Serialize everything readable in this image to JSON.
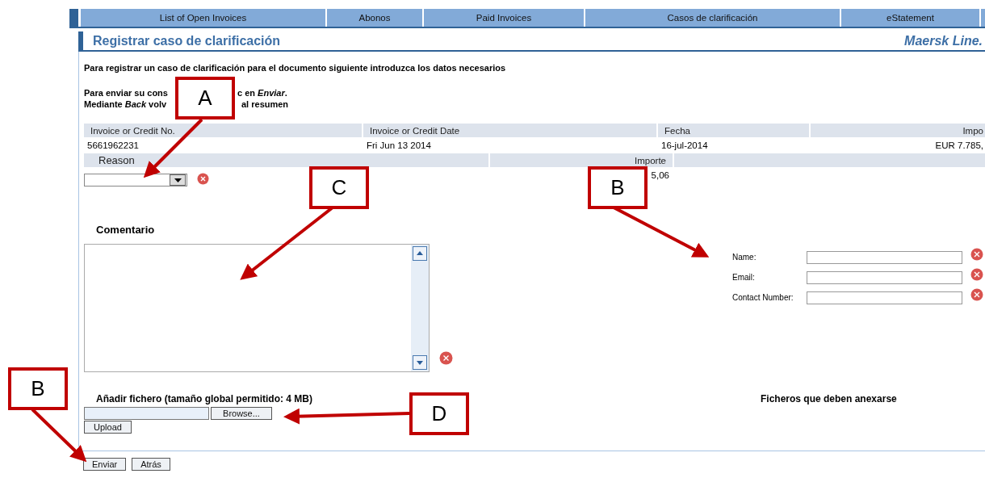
{
  "nav_tabs": [
    "List of Open Invoices",
    "Abonos",
    "Paid Invoices",
    "Casos de clarificación",
    "eStatement"
  ],
  "page_title": "Registrar caso de clarificación",
  "brand": "Maersk Line.",
  "intro": "Para registrar un caso de clarificación para el documento siguiente introduzca los datos necesarios",
  "instructions": [
    {
      "before": "Para enviar su cons",
      "after": "c en *Enviar*."
    },
    {
      "before": "Mediante *Back* volv",
      "after": "al resumen"
    }
  ],
  "invoice_table": {
    "columns": [
      "Invoice or Credit No.",
      "Invoice or Credit Date",
      "Fecha",
      "Impo"
    ],
    "row": [
      "5661962231",
      "Fri Jun 13 2014",
      "16-jul-2014",
      "EUR 7.785,"
    ]
  },
  "reason": {
    "label": "Reason",
    "amount_label": "Importe",
    "amount": "5,06"
  },
  "comment": {
    "label": "Comentario"
  },
  "contact_fields": [
    {
      "label": "Name:"
    },
    {
      "label": "Email:"
    },
    {
      "label": "Contact Number:"
    }
  ],
  "attachment": {
    "label": "Añadir fichero (tamaño global permitido: 4 MB)",
    "browse": "Browse...",
    "upload": "Upload",
    "required_files": "Ficheros que deben anexarse"
  },
  "actions": [
    "Enviar",
    "Atrás"
  ],
  "callouts": [
    {
      "letter": "A"
    },
    {
      "letter": "C"
    },
    {
      "letter": "B"
    },
    {
      "letter": "B"
    },
    {
      "letter": "D"
    }
  ]
}
